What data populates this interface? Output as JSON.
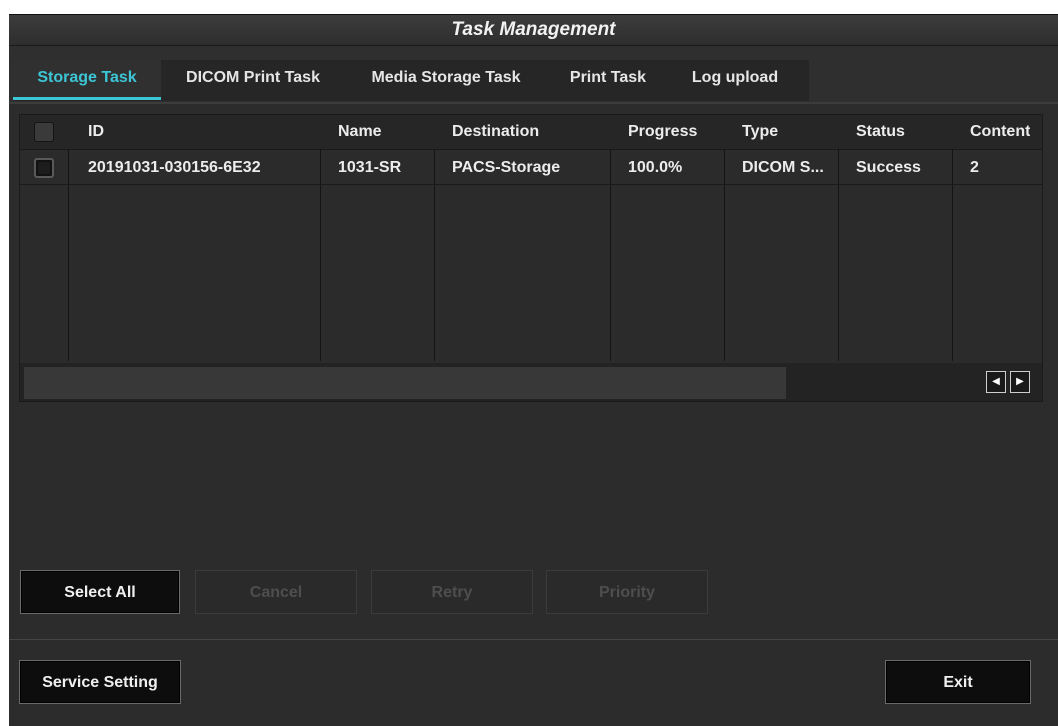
{
  "window": {
    "title": "Task Management"
  },
  "tabs": [
    {
      "label": "Storage Task",
      "active": true
    },
    {
      "label": "DICOM Print Task",
      "active": false
    },
    {
      "label": "Media Storage Task",
      "active": false
    },
    {
      "label": "Print Task",
      "active": false
    },
    {
      "label": "Log upload",
      "active": false
    }
  ],
  "table": {
    "columns": [
      "ID",
      "Name",
      "Destination",
      "Progress",
      "Type",
      "Status",
      "Content"
    ],
    "rows": [
      {
        "checked": false,
        "cells": [
          "20191031-030156-6E32",
          "1031-SR",
          "PACS-Storage",
          "100.0%",
          "DICOM S...",
          "Success",
          "2"
        ]
      }
    ]
  },
  "scroll": {
    "left_icon": "scroll-left-icon",
    "right_icon": "scroll-right-icon",
    "left_glyph": "◀",
    "right_glyph": "▶"
  },
  "actions": {
    "select_all": "Select All",
    "cancel": "Cancel",
    "retry": "Retry",
    "priority": "Priority"
  },
  "footer": {
    "service_setting": "Service Setting",
    "exit": "Exit"
  },
  "colors": {
    "accent": "#3cc6d6",
    "background": "#2c2c2c"
  }
}
